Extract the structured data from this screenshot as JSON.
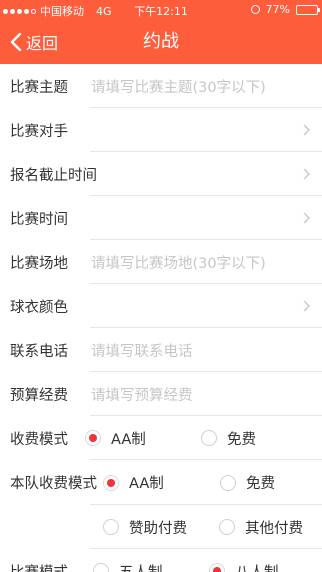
{
  "status_bar": {
    "carrier": "中国移动",
    "network": "4G",
    "time": "下午12:11",
    "battery": "77%",
    "battery_level": 0.77
  },
  "nav": {
    "back_label": "返回",
    "title": "约战"
  },
  "form": {
    "topic": {
      "label": "比赛主题",
      "placeholder": "请填写比赛主题(30字以下)"
    },
    "opponent": {
      "label": "比赛对手"
    },
    "deadline": {
      "label": "报名截止时间"
    },
    "match_time": {
      "label": "比赛时间"
    },
    "venue": {
      "label": "比赛场地",
      "placeholder": "请填写比赛场地(30字以下)"
    },
    "jersey": {
      "label": "球衣颜色"
    },
    "phone": {
      "label": "联系电话",
      "placeholder": "请填写联系电话"
    },
    "budget": {
      "label": "预算经费",
      "placeholder": "请填写预算经费"
    },
    "fee_mode": {
      "label": "收费模式",
      "options": [
        "AA制",
        "免费"
      ],
      "selected": "AA制"
    },
    "team_fee_mode": {
      "label": "本队收费模式",
      "options": [
        "AA制",
        "免费",
        "赞助付费",
        "其他付费"
      ],
      "selected": "AA制"
    },
    "match_mode": {
      "label": "比赛模式",
      "options": [
        "五人制",
        "八人制"
      ],
      "selected": "八人制"
    }
  },
  "colors": {
    "accent": "#fe5d3c",
    "radio_selected": "#f3323a",
    "placeholder": "#c6c6c6"
  }
}
